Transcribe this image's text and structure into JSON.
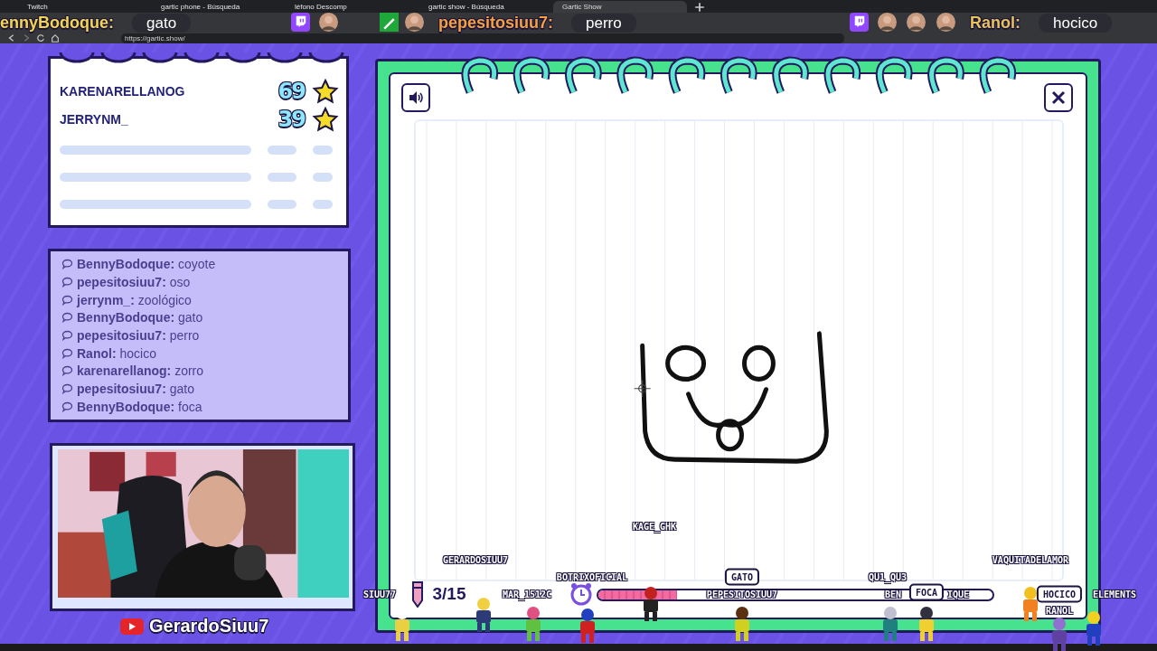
{
  "browser": {
    "tabs": [
      {
        "title": "Twitch",
        "selected": false
      },
      {
        "title": "gartic phone - Búsqueda",
        "selected": false
      },
      {
        "title": "léfono Descomp",
        "selected": false
      },
      {
        "title": "gartic show - Búsqueda",
        "selected": false
      },
      {
        "title": "Gartic Show",
        "selected": true
      }
    ],
    "address": "https://gartic.show/"
  },
  "popups": [
    {
      "user": "ennyBodoque:",
      "message": "gato"
    },
    {
      "user": "pepesitosiuu7:",
      "message": "perro"
    },
    {
      "user": "Ranol:",
      "message": "hocico"
    }
  ],
  "scoreboard": {
    "players": [
      {
        "name": "KARENARELLANOG",
        "score": "69"
      },
      {
        "name": "JERRYNM_",
        "score": "39"
      }
    ]
  },
  "chat": [
    {
      "user": "BennyBodoque:",
      "message": "coyote"
    },
    {
      "user": "pepesitosiuu7:",
      "message": "oso"
    },
    {
      "user": "jerrynm_:",
      "message": "zoológico"
    },
    {
      "user": "BennyBodoque:",
      "message": "gato"
    },
    {
      "user": "pepesitosiuu7:",
      "message": "perro"
    },
    {
      "user": "Ranol:",
      "message": "hocico"
    },
    {
      "user": "karenarellanog:",
      "message": "zorro"
    },
    {
      "user": "pepesitosiuu7:",
      "message": "gato"
    },
    {
      "user": "BennyBodoque:",
      "message": "foca"
    }
  ],
  "webcam": {
    "kind": "picture",
    "channel": "GerardoSiuu7"
  },
  "game": {
    "round": "3/15",
    "timer": {
      "level": 0.2
    },
    "players": [
      {
        "name": "SIUU77"
      },
      {
        "name": "GERARDOSIUU7"
      },
      {
        "name": "MAR_1512C"
      },
      {
        "name": "BOTRIXOFICIAL"
      },
      {
        "name": "KAGE_GHK"
      },
      {
        "name": "PEPESITOSIUU7",
        "bubble": "GATO"
      },
      {
        "name": "QU1_QU3"
      },
      {
        "name": "BEN",
        "name_tail": "IQUE",
        "bubble": "FOCA"
      },
      {
        "name": "VAQUITADELAMOR"
      },
      {
        "name": "RANOL",
        "bubble": "HOCICO"
      },
      {
        "name": "ELEMENTS"
      }
    ]
  }
}
